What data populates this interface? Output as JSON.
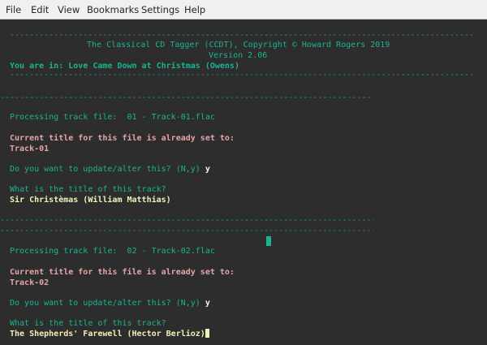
{
  "menu": {
    "items": [
      "File",
      "Edit",
      "View",
      "Bookmarks",
      "Settings",
      "Help"
    ]
  },
  "header": {
    "rule": "-----------------------------------------------------------------------------------------------",
    "title": "The Classical CD Tagger (CCDT), Copyright © Howard Rogers 2019",
    "version": "Version 2.06",
    "location": "You are in: Love Came Down at Christmas (Owens)"
  },
  "separator": "------------------------------------------------------------------------------------------------",
  "tracks": [
    {
      "processing": "Processing track file:  01 - Track-01.flac",
      "current_title_label": "Current title for this file is already set to:",
      "current_title": "Track-01",
      "update_prompt": "Do you want to update/alter this? (N,y) ",
      "update_answer": "y",
      "title_prompt": "What is the title of this track?",
      "title_answer": "Sir Christèmas (William Matthias)"
    },
    {
      "processing": "Processing track file:  02 - Track-02.flac",
      "current_title_label": "Current title for this file is already set to:",
      "current_title": "Track-02",
      "update_prompt": "Do you want to update/alter this? (N,y) ",
      "update_answer": "y",
      "title_prompt": "What is the title of this track?",
      "title_answer": "The Shepherds' Farewell (Hector Berlioz)"
    }
  ]
}
